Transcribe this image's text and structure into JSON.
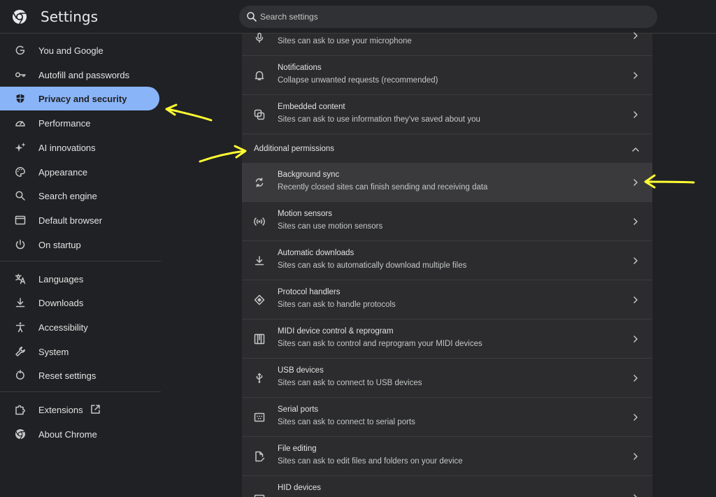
{
  "header": {
    "title": "Settings",
    "search_placeholder": "Search settings"
  },
  "sidebar": {
    "items": [
      {
        "label": "You and Google",
        "icon": "google-g-icon"
      },
      {
        "label": "Autofill and passwords",
        "icon": "key-icon"
      },
      {
        "label": "Privacy and security",
        "icon": "shield-icon",
        "active": true
      },
      {
        "label": "Performance",
        "icon": "speedometer-icon"
      },
      {
        "label": "AI innovations",
        "icon": "sparkle-icon"
      },
      {
        "label": "Appearance",
        "icon": "palette-icon"
      },
      {
        "label": "Search engine",
        "icon": "search-icon"
      },
      {
        "label": "Default browser",
        "icon": "browser-window-icon"
      },
      {
        "label": "On startup",
        "icon": "power-icon"
      },
      {
        "label": "Languages",
        "icon": "translate-icon"
      },
      {
        "label": "Downloads",
        "icon": "download-icon"
      },
      {
        "label": "Accessibility",
        "icon": "accessibility-icon"
      },
      {
        "label": "System",
        "icon": "wrench-icon"
      },
      {
        "label": "Reset settings",
        "icon": "reset-icon"
      },
      {
        "label": "Extensions",
        "icon": "puzzle-icon"
      },
      {
        "label": "About Chrome",
        "icon": "chrome-icon"
      }
    ]
  },
  "content": {
    "rows_top": [
      {
        "title": "",
        "subtitle": "Sites can ask to use your microphone",
        "icon": "microphone-icon"
      },
      {
        "title": "Notifications",
        "subtitle": "Collapse unwanted requests (recommended)",
        "icon": "bell-icon"
      },
      {
        "title": "Embedded content",
        "subtitle": "Sites can ask to use information they've saved about you",
        "icon": "embedded-content-icon"
      }
    ],
    "section_title": "Additional permissions",
    "rows": [
      {
        "title": "Background sync",
        "subtitle": "Recently closed sites can finish sending and receiving data",
        "icon": "sync-icon"
      },
      {
        "title": "Motion sensors",
        "subtitle": "Sites can use motion sensors",
        "icon": "sensors-icon"
      },
      {
        "title": "Automatic downloads",
        "subtitle": "Sites can ask to automatically download multiple files",
        "icon": "download-icon"
      },
      {
        "title": "Protocol handlers",
        "subtitle": "Sites can ask to handle protocols",
        "icon": "protocol-icon"
      },
      {
        "title": "MIDI device control & reprogram",
        "subtitle": "Sites can ask to control and reprogram your MIDI devices",
        "icon": "piano-icon"
      },
      {
        "title": "USB devices",
        "subtitle": "Sites can ask to connect to USB devices",
        "icon": "usb-icon"
      },
      {
        "title": "Serial ports",
        "subtitle": "Sites can ask to connect to serial ports",
        "icon": "serial-port-icon"
      },
      {
        "title": "File editing",
        "subtitle": "Sites can ask to edit files and folders on your device",
        "icon": "file-edit-icon"
      },
      {
        "title": "HID devices",
        "subtitle": "",
        "icon": "hid-icon"
      }
    ]
  },
  "colors": {
    "accent": "#8ab4f8",
    "annotation": "#ffff33"
  }
}
